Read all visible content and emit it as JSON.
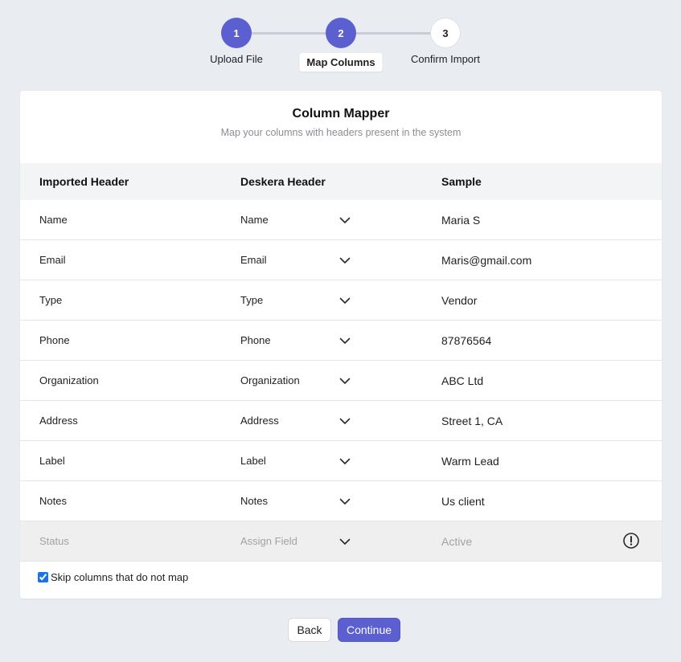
{
  "stepper": {
    "steps": [
      {
        "number": "1",
        "label": "Upload File",
        "state": "done"
      },
      {
        "number": "2",
        "label": "Map Columns",
        "state": "active"
      },
      {
        "number": "3",
        "label": "Confirm Import",
        "state": "todo"
      }
    ]
  },
  "mapper": {
    "title": "Column Mapper",
    "subtitle": "Map your columns with headers present in the system",
    "headers": {
      "imported": "Imported Header",
      "deskera": "Deskera Header",
      "sample": "Sample"
    },
    "rows": [
      {
        "imported": "Name",
        "deskera": "Name",
        "sample": "Maria S"
      },
      {
        "imported": "Email",
        "deskera": "Email",
        "sample": "Maris@gmail.com"
      },
      {
        "imported": "Type",
        "deskera": "Type",
        "sample": "Vendor"
      },
      {
        "imported": "Phone",
        "deskera": "Phone",
        "sample": "87876564"
      },
      {
        "imported": "Organization",
        "deskera": "Organization",
        "sample": "ABC Ltd"
      },
      {
        "imported": "Address",
        "deskera": "Address",
        "sample": "Street 1, CA"
      },
      {
        "imported": "Label",
        "deskera": "Label",
        "sample": "Warm Lead"
      },
      {
        "imported": "Notes",
        "deskera": "Notes",
        "sample": "Us client"
      },
      {
        "imported": "Status",
        "deskera": "Assign Field",
        "sample": "Active"
      }
    ],
    "skip_label": "Skip columns that do not map",
    "skip_checked": true
  },
  "footer": {
    "back_label": "Back",
    "continue_label": "Continue"
  },
  "colors": {
    "accent": "#5b5fcf",
    "background": "#e9ecf1",
    "unmapped_row": "#efefef"
  },
  "icons": {
    "dropdown": "chevron-down-icon",
    "warning": "info-icon"
  }
}
